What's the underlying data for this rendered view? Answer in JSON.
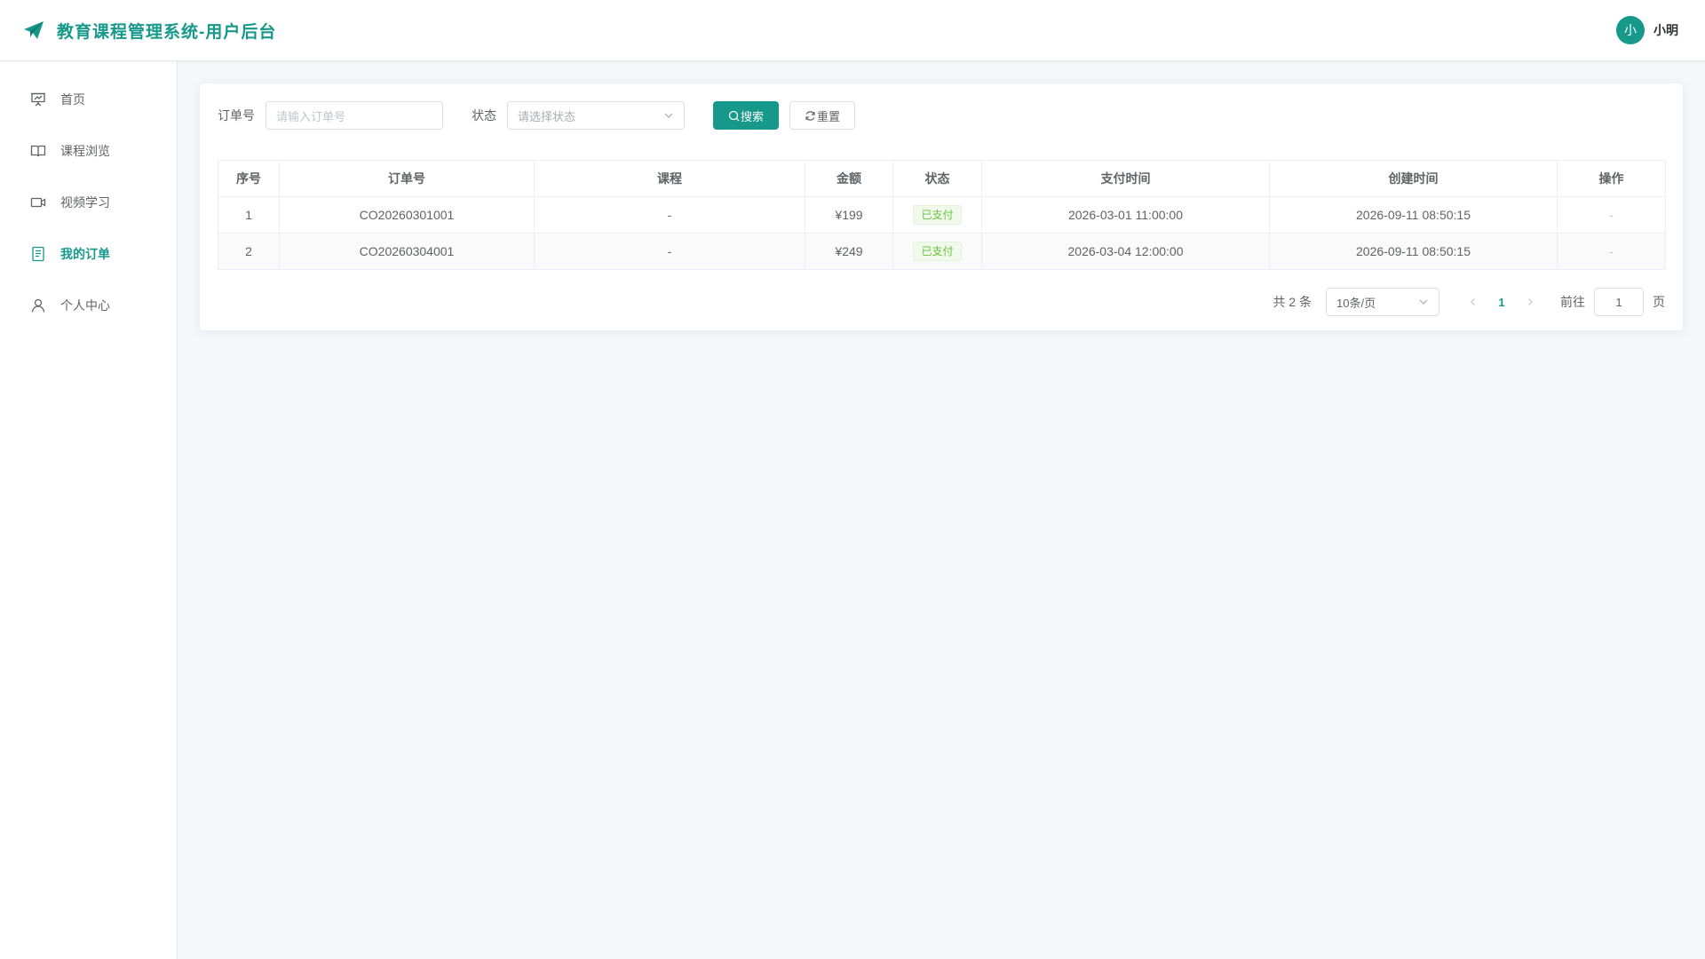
{
  "header": {
    "title": "教育课程管理系统-用户后台",
    "avatar_text": "小",
    "username": "小明"
  },
  "sidebar": {
    "items": [
      {
        "label": "首页",
        "icon": "presentation-icon"
      },
      {
        "label": "课程浏览",
        "icon": "book-open-icon"
      },
      {
        "label": "视频学习",
        "icon": "video-camera-icon"
      },
      {
        "label": "我的订单",
        "icon": "document-list-icon",
        "active": true
      },
      {
        "label": "个人中心",
        "icon": "user-icon"
      }
    ]
  },
  "search": {
    "order_label": "订单号",
    "order_placeholder": "请输入订单号",
    "status_label": "状态",
    "status_placeholder": "请选择状态",
    "search_button": "搜索",
    "reset_button": "重置"
  },
  "table": {
    "columns": [
      "序号",
      "订单号",
      "课程",
      "金额",
      "状态",
      "支付时间",
      "创建时间",
      "操作"
    ],
    "rows": [
      {
        "index": "1",
        "order_no": "CO20260301001",
        "course": "-",
        "amount": "¥199",
        "status": "已支付",
        "paid_at": "2026-03-01 11:00:00",
        "created_at": "2026-09-11 08:50:15",
        "action": "-"
      },
      {
        "index": "2",
        "order_no": "CO20260304001",
        "course": "-",
        "amount": "¥249",
        "status": "已支付",
        "paid_at": "2026-03-04 12:00:00",
        "created_at": "2026-09-11 08:50:15",
        "action": "-"
      }
    ]
  },
  "pagination": {
    "total": "共 2 条",
    "page_size": "10条/页",
    "current_page": "1",
    "goto_label": "前往",
    "goto_value": "1",
    "page_suffix": "页"
  },
  "colors": {
    "brand": "#16988a",
    "status_success": "#67c23a"
  }
}
